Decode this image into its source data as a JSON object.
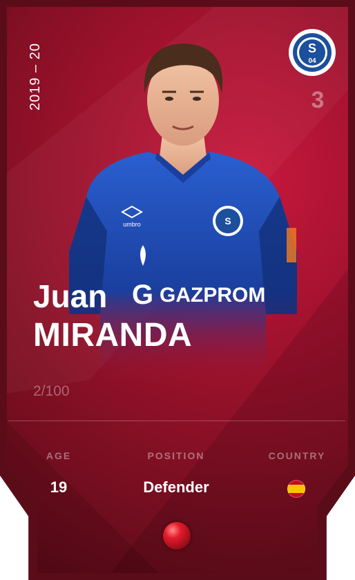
{
  "card": {
    "season": "2019 – 20",
    "club": "Schalke 04",
    "club_badge_text": "S 04",
    "rarity_number": "3",
    "player": {
      "first_name": "Juan",
      "last_name": "MIRANDA",
      "shirt_sponsor": "GAZPROM",
      "kit_brand": "umbro"
    },
    "serial": "2/100",
    "stats": {
      "age_label": "AGE",
      "age_value": "19",
      "position_label": "POSITION",
      "position_value": "Defender",
      "country_label": "COUNTRY",
      "country_flag": "spain-flag-icon"
    },
    "colors": {
      "card_primary": "#a3122f",
      "card_dark": "#5a0b18",
      "shirt_blue": "#1e4fb8",
      "text": "#ffffff"
    }
  }
}
